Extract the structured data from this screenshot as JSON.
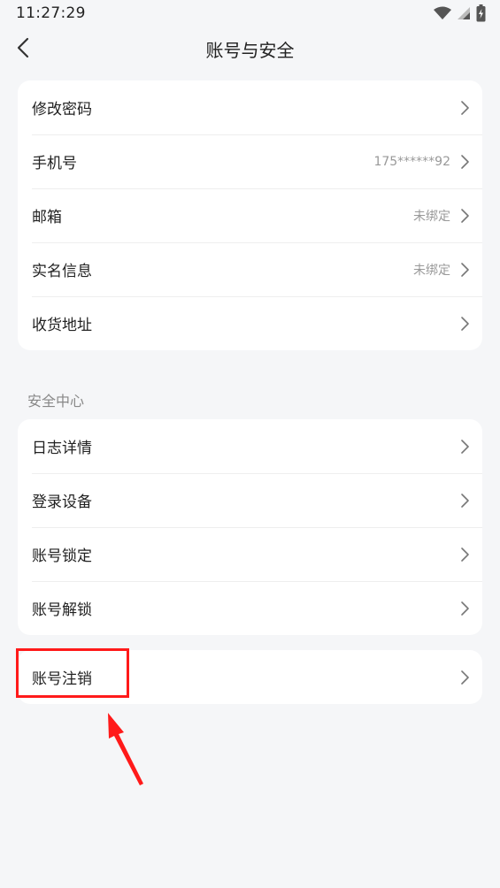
{
  "status_bar": {
    "time": "11:27:29",
    "icons": [
      "wifi-icon",
      "signal-icon",
      "battery-charging-icon"
    ]
  },
  "header": {
    "title": "账号与安全",
    "back_icon": "chevron-left-icon"
  },
  "account_group": {
    "items": [
      {
        "label": "修改密码",
        "value": ""
      },
      {
        "label": "手机号",
        "value": "175******92"
      },
      {
        "label": "邮箱",
        "value": "未绑定"
      },
      {
        "label": "实名信息",
        "value": "未绑定"
      },
      {
        "label": "收货地址",
        "value": ""
      }
    ]
  },
  "security_center": {
    "title": "安全中心",
    "items": [
      {
        "label": "日志详情"
      },
      {
        "label": "登录设备"
      },
      {
        "label": "账号锁定"
      },
      {
        "label": "账号解锁"
      }
    ]
  },
  "cancel_group": {
    "items": [
      {
        "label": "账号注销"
      }
    ]
  },
  "colors": {
    "background": "#f5f6f8",
    "card": "#ffffff",
    "text_primary": "#222222",
    "text_secondary": "#999999",
    "annotation": "#ff1a1a"
  }
}
